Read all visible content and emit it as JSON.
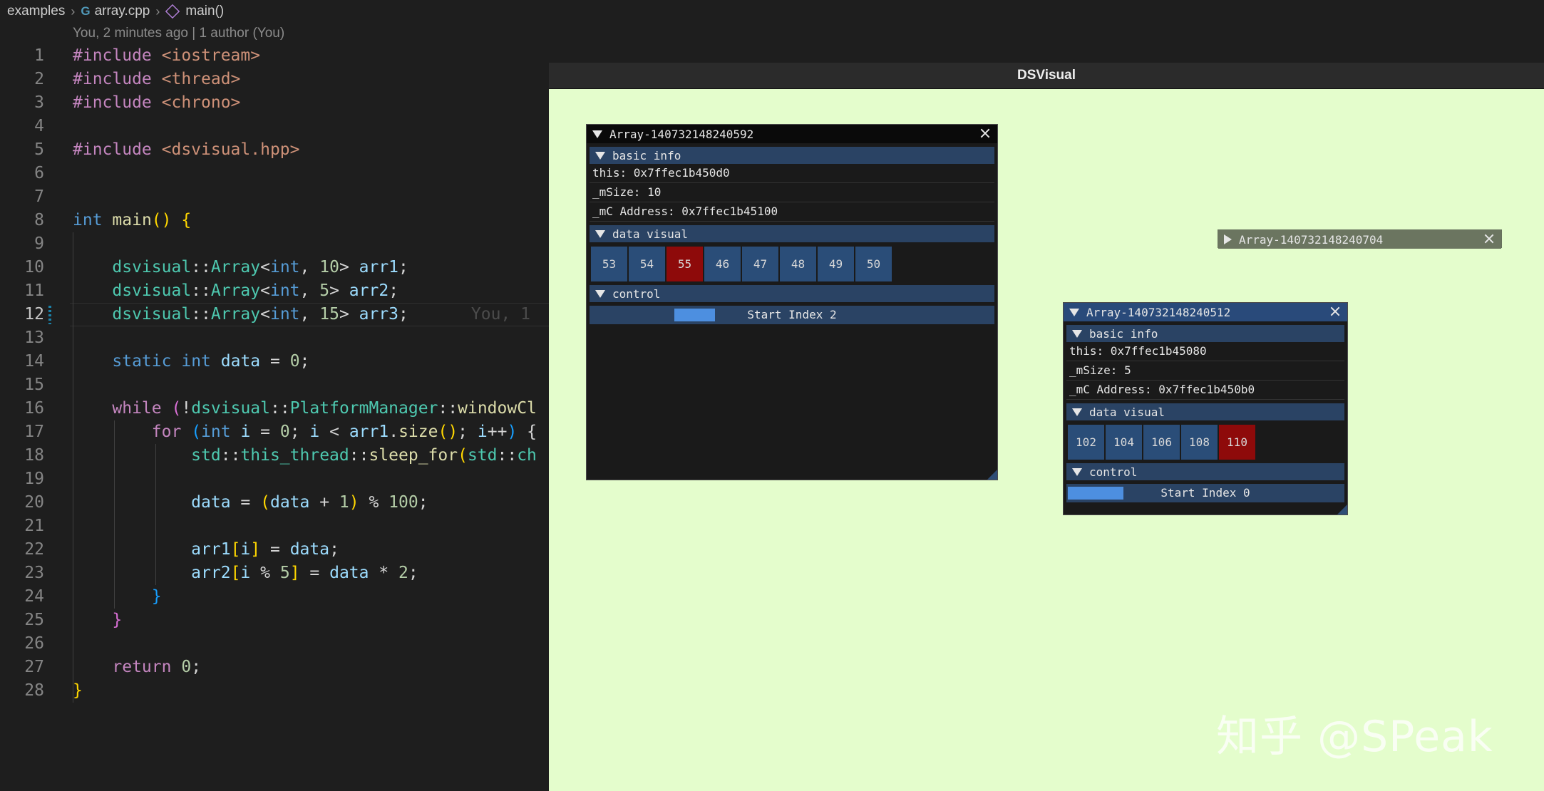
{
  "breadcrumb": {
    "folder": "examples",
    "file": "array.cpp",
    "symbol": "main()"
  },
  "blame_header": "You, 2 minutes ago | 1 author (You)",
  "blame_inline": "You, 1",
  "code_lines": [
    {
      "n": "1"
    },
    {
      "n": "2"
    },
    {
      "n": "3"
    },
    {
      "n": "4"
    },
    {
      "n": "5"
    },
    {
      "n": "6"
    },
    {
      "n": "7"
    },
    {
      "n": "8"
    },
    {
      "n": "9"
    },
    {
      "n": "10"
    },
    {
      "n": "11"
    },
    {
      "n": "12"
    },
    {
      "n": "13"
    },
    {
      "n": "14"
    },
    {
      "n": "15"
    },
    {
      "n": "16"
    },
    {
      "n": "17"
    },
    {
      "n": "18"
    },
    {
      "n": "19"
    },
    {
      "n": "20"
    },
    {
      "n": "21"
    },
    {
      "n": "22"
    },
    {
      "n": "23"
    },
    {
      "n": "24"
    },
    {
      "n": "25"
    },
    {
      "n": "26"
    },
    {
      "n": "27"
    },
    {
      "n": "28"
    }
  ],
  "code": {
    "l1": [
      [
        "k-inc",
        "#include"
      ],
      [
        "k-str",
        " <iostream>"
      ]
    ],
    "l2": [
      [
        "k-inc",
        "#include"
      ],
      [
        "k-str",
        " <thread>"
      ]
    ],
    "l3": [
      [
        "k-inc",
        "#include"
      ],
      [
        "k-str",
        " <chrono>"
      ]
    ],
    "l4": [],
    "l5": [
      [
        "k-inc",
        "#include"
      ],
      [
        "k-str",
        " <dsvisual.hpp>"
      ]
    ],
    "l6": [],
    "l7": [],
    "l8": [
      [
        "k-type",
        "int"
      ],
      [
        "",
        " "
      ],
      [
        "k-fn",
        "main"
      ],
      [
        "k-br1",
        "()"
      ],
      [
        "",
        " "
      ],
      [
        "k-br1",
        "{"
      ]
    ],
    "l9": [],
    "l10": [
      [
        "",
        "    "
      ],
      [
        "k-ns",
        "dsvisual"
      ],
      [
        "",
        "::"
      ],
      [
        "k-ns",
        "Array"
      ],
      [
        "",
        "<"
      ],
      [
        "k-type",
        "int"
      ],
      [
        "",
        ", "
      ],
      [
        "k-num",
        "10"
      ],
      [
        "",
        "> "
      ],
      [
        "k-var",
        "arr1"
      ],
      [
        "",
        ";"
      ]
    ],
    "l11": [
      [
        "",
        "    "
      ],
      [
        "k-ns",
        "dsvisual"
      ],
      [
        "",
        "::"
      ],
      [
        "k-ns",
        "Array"
      ],
      [
        "",
        "<"
      ],
      [
        "k-type",
        "int"
      ],
      [
        "",
        ", "
      ],
      [
        "k-num",
        "5"
      ],
      [
        "",
        "> "
      ],
      [
        "k-var",
        "arr2"
      ],
      [
        "",
        ";"
      ]
    ],
    "l12": [
      [
        "",
        "    "
      ],
      [
        "k-ns",
        "dsvisual"
      ],
      [
        "",
        "::"
      ],
      [
        "k-ns",
        "Array"
      ],
      [
        "",
        "<"
      ],
      [
        "k-type",
        "int"
      ],
      [
        "",
        ", "
      ],
      [
        "k-num",
        "15"
      ],
      [
        "",
        "> "
      ],
      [
        "k-var",
        "arr3"
      ],
      [
        "",
        ";"
      ]
    ],
    "l13": [],
    "l14": [
      [
        "",
        "    "
      ],
      [
        "k-type",
        "static"
      ],
      [
        "",
        " "
      ],
      [
        "k-type",
        "int"
      ],
      [
        "",
        " "
      ],
      [
        "k-var",
        "data"
      ],
      [
        "",
        " = "
      ],
      [
        "k-num",
        "0"
      ],
      [
        "",
        ";"
      ]
    ],
    "l15": [],
    "l16": [
      [
        "",
        "    "
      ],
      [
        "k-ctrl",
        "while"
      ],
      [
        "",
        " "
      ],
      [
        "k-br2",
        "("
      ],
      [
        "",
        "!"
      ],
      [
        "k-ns",
        "dsvisual"
      ],
      [
        "",
        "::"
      ],
      [
        "k-ns",
        "PlatformManager"
      ],
      [
        "",
        "::"
      ],
      [
        "k-fn",
        "windowCl"
      ]
    ],
    "l17": [
      [
        "",
        "        "
      ],
      [
        "k-ctrl",
        "for"
      ],
      [
        "",
        " "
      ],
      [
        "k-br3",
        "("
      ],
      [
        "k-type",
        "int"
      ],
      [
        "",
        " "
      ],
      [
        "k-var",
        "i"
      ],
      [
        "",
        " = "
      ],
      [
        "k-num",
        "0"
      ],
      [
        "",
        "; "
      ],
      [
        "k-var",
        "i"
      ],
      [
        "",
        " < "
      ],
      [
        "k-var",
        "arr1"
      ],
      [
        "",
        "."
      ],
      [
        "k-fn",
        "size"
      ],
      [
        "k-br1",
        "()"
      ],
      [
        "",
        "; "
      ],
      [
        "k-var",
        "i"
      ],
      [
        "",
        "++"
      ],
      [
        "k-br3",
        ")"
      ],
      [
        "",
        " {"
      ]
    ],
    "l18": [
      [
        "",
        "            "
      ],
      [
        "k-ns",
        "std"
      ],
      [
        "",
        "::"
      ],
      [
        "k-ns",
        "this_thread"
      ],
      [
        "",
        "::"
      ],
      [
        "k-fn",
        "sleep_for"
      ],
      [
        "k-br1",
        "("
      ],
      [
        "k-ns",
        "std"
      ],
      [
        "",
        "::"
      ],
      [
        "k-ns",
        "ch"
      ]
    ],
    "l19": [],
    "l20": [
      [
        "",
        "            "
      ],
      [
        "k-var",
        "data"
      ],
      [
        "",
        " = "
      ],
      [
        "k-br1",
        "("
      ],
      [
        "k-var",
        "data"
      ],
      [
        "",
        " + "
      ],
      [
        "k-num",
        "1"
      ],
      [
        "k-br1",
        ")"
      ],
      [
        "",
        " % "
      ],
      [
        "k-num",
        "100"
      ],
      [
        "",
        ";"
      ]
    ],
    "l21": [],
    "l22": [
      [
        "",
        "            "
      ],
      [
        "k-var",
        "arr1"
      ],
      [
        "k-br1",
        "["
      ],
      [
        "k-var",
        "i"
      ],
      [
        "k-br1",
        "]"
      ],
      [
        "",
        " = "
      ],
      [
        "k-var",
        "data"
      ],
      [
        "",
        ";"
      ]
    ],
    "l23": [
      [
        "",
        "            "
      ],
      [
        "k-var",
        "arr2"
      ],
      [
        "k-br1",
        "["
      ],
      [
        "k-var",
        "i"
      ],
      [
        "",
        " % "
      ],
      [
        "k-num",
        "5"
      ],
      [
        "k-br1",
        "]"
      ],
      [
        "",
        " = "
      ],
      [
        "k-var",
        "data"
      ],
      [
        "",
        " * "
      ],
      [
        "k-num",
        "2"
      ],
      [
        "",
        ";"
      ]
    ],
    "l24": [
      [
        "",
        "        "
      ],
      [
        "k-br3",
        "}"
      ]
    ],
    "l25": [
      [
        "",
        "    "
      ],
      [
        "k-br2",
        "}"
      ]
    ],
    "l26": [],
    "l27": [
      [
        "",
        "    "
      ],
      [
        "k-ctrl",
        "return"
      ],
      [
        "",
        " "
      ],
      [
        "k-num",
        "0"
      ],
      [
        "",
        ";"
      ]
    ],
    "l28": [
      [
        "k-br1",
        "}"
      ]
    ]
  },
  "dsvisual": {
    "window_title": "DSVisual",
    "panel1": {
      "title": "Array-140732148240592",
      "section_basic": "basic info",
      "this": "this: 0x7ffec1b450d0",
      "msize": "_mSize: 10",
      "mc_address": "_mC Address: 0x7ffec1b45100",
      "section_visual": "data visual",
      "cells": [
        "53",
        "54",
        "55",
        "46",
        "47",
        "48",
        "49",
        "50"
      ],
      "highlight_index": 2,
      "section_control": "control",
      "control_label": "Start Index 2",
      "progress": 0.1
    },
    "panel2": {
      "title": "Array-140732148240704"
    },
    "panel3": {
      "title": "Array-140732148240512",
      "section_basic": "basic info",
      "this": "this: 0x7ffec1b45080",
      "msize": "_mSize: 5",
      "mc_address": "_mC Address: 0x7ffec1b450b0",
      "section_visual": "data visual",
      "cells": [
        "102",
        "104",
        "106",
        "108",
        "110"
      ],
      "highlight_index": 4,
      "section_control": "control",
      "control_label": "Start Index 0",
      "progress": 0.2
    }
  },
  "watermark": "知乎 @SPeak",
  "colors": {
    "editor_bg": "#1e1e1e",
    "canvas_bg": "#e4fdcc",
    "cell": "#2a4d78",
    "cell_highlight": "#8e0a0a"
  }
}
